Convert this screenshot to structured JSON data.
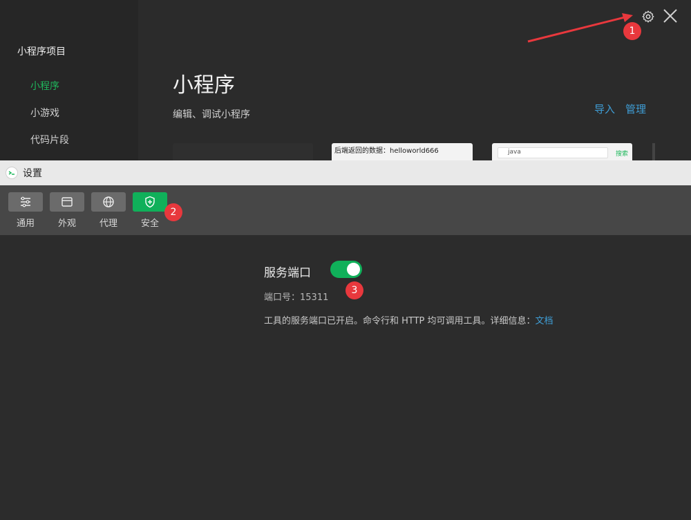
{
  "main_window": {
    "sidebar_title": "小程序项目",
    "nav_items": [
      {
        "label": "小程序",
        "active": true
      },
      {
        "label": "小游戏",
        "active": false
      },
      {
        "label": "代码片段",
        "active": false
      }
    ],
    "heading": "小程序",
    "subheading": "编辑、调试小程序",
    "links": {
      "import": "导入",
      "manage": "管理"
    },
    "thumbnails": {
      "thumb1_text": "后端返回的数据：helloworld666",
      "thumb2_search_value": "java",
      "thumb2_search_button": "搜索"
    },
    "icons": {
      "settings": "gear-icon",
      "close": "close-icon"
    }
  },
  "annotations": {
    "badge1": "1",
    "badge2": "2",
    "badge3": "3",
    "badge_color": "#e8383d"
  },
  "settings_dialog": {
    "title": "设置",
    "tabs": [
      {
        "label": "通用",
        "icon": "sliders-icon",
        "active": false
      },
      {
        "label": "外观",
        "icon": "window-icon",
        "active": false
      },
      {
        "label": "代理",
        "icon": "globe-icon",
        "active": false
      },
      {
        "label": "安全",
        "icon": "shield-icon",
        "active": true
      }
    ],
    "service_port": {
      "title": "服务端口",
      "enabled": true,
      "port_label": "端口号：",
      "port_value": "15311",
      "description": "工具的服务端口已开启。命令行和 HTTP 均可调用工具。详细信息：",
      "doc_link": "文档"
    }
  },
  "colors": {
    "accent_green": "#10b05a",
    "link_blue": "#3f9ed6",
    "annotation_red": "#e8383d"
  }
}
